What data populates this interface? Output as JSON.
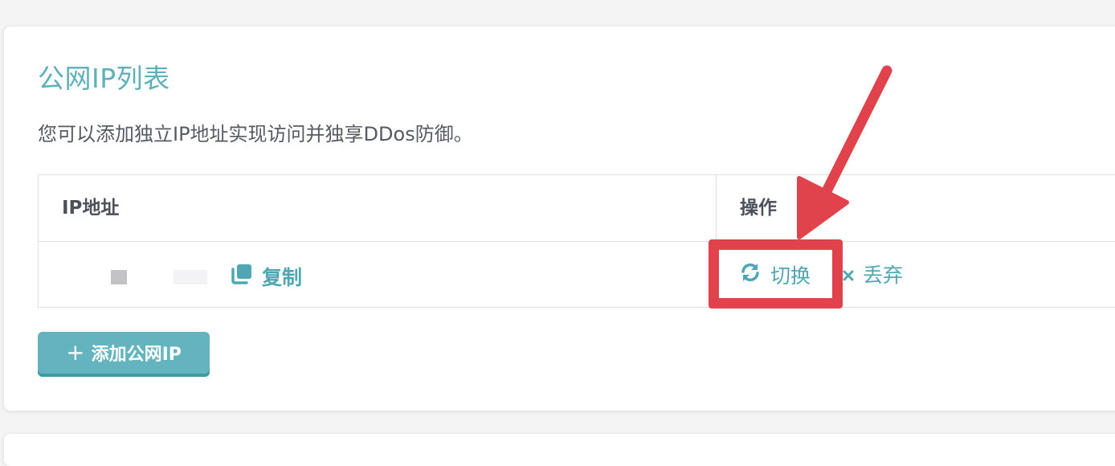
{
  "card": {
    "title": "公网IP列表",
    "description": "您可以添加独立IP地址实现访问并独享DDos防御。"
  },
  "table": {
    "headers": [
      "IP地址",
      "操作"
    ],
    "rows": [
      {
        "copy_label": "复制",
        "actions": [
          {
            "label": "切换",
            "icon": "refresh-icon"
          },
          {
            "label": "丢弃",
            "icon": "close-icon"
          }
        ]
      }
    ]
  },
  "add_button": {
    "plus": "+",
    "label": "添加公网IP"
  },
  "annotation": {
    "color": "#e1434d",
    "target": "切换"
  },
  "colors": {
    "accent": "#5fb0bb",
    "button": "#63b4bf"
  }
}
